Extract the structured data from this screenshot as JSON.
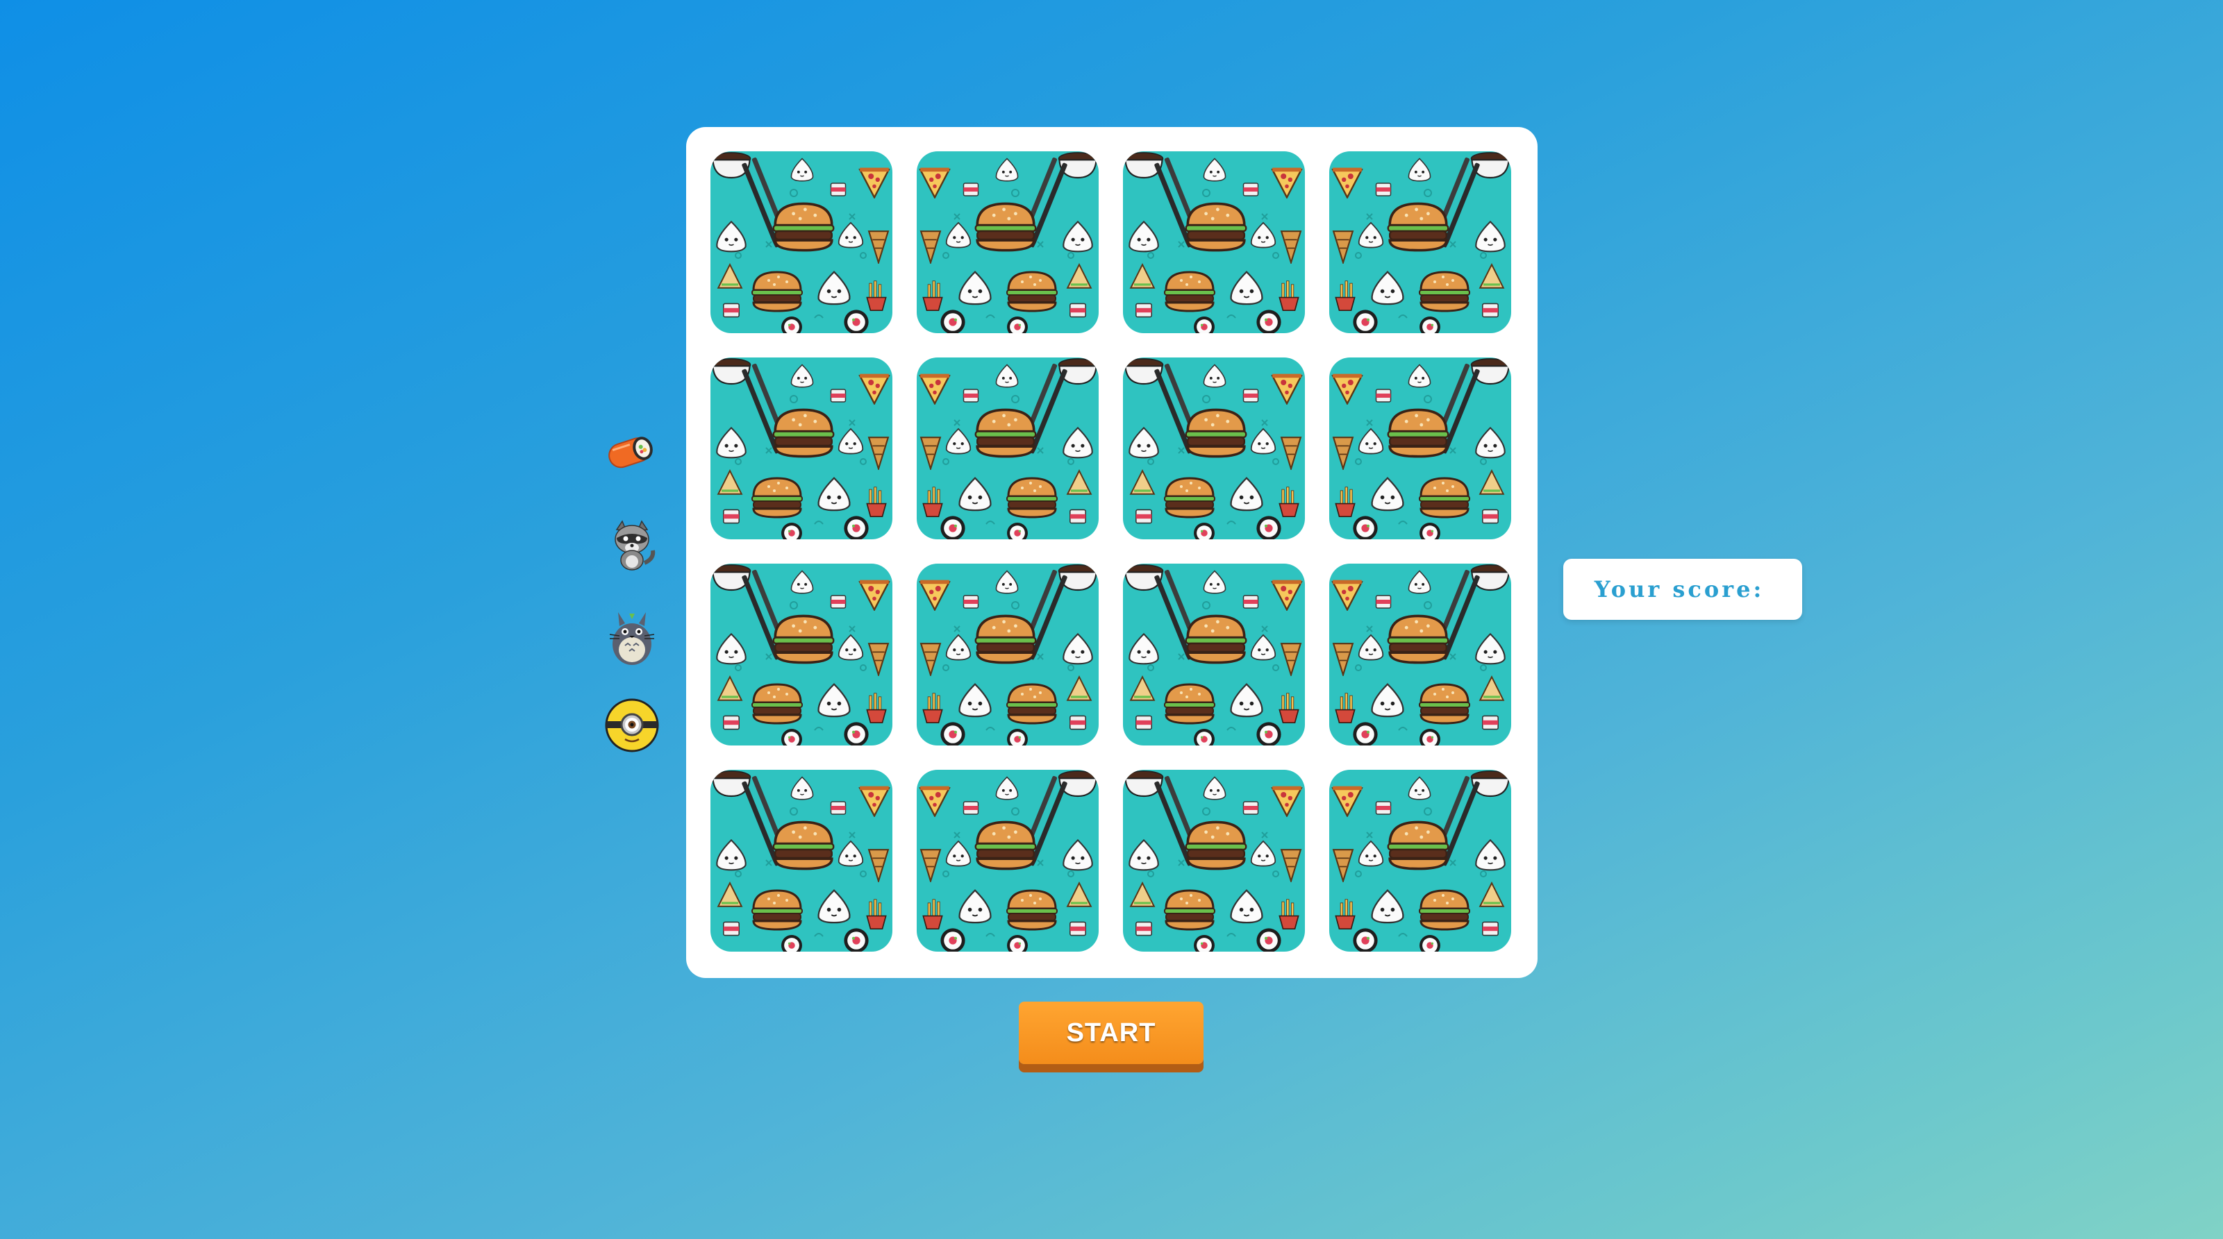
{
  "game": {
    "score_label": "Your score:",
    "score_value": "",
    "start_label": "START"
  },
  "themes": [
    {
      "icon": "sushi-roll-icon",
      "name": "sushi"
    },
    {
      "icon": "raccoon-icon",
      "name": "raccoon"
    },
    {
      "icon": "totoro-icon",
      "name": "totoro"
    },
    {
      "icon": "minion-icon",
      "name": "minion"
    }
  ],
  "board": {
    "rows": 4,
    "columns": 4,
    "card_back": "food-pattern (burgers, onigiri, pizza, sushi, chopsticks)",
    "face_down_cards": 16
  },
  "colors": {
    "background_top": "#0f8fe6",
    "background_bottom": "#80d2c6",
    "card_back": "#2fc3c0",
    "button": "#f7941d",
    "button_shadow": "#b25d15",
    "score_text": "#2a9fd0"
  }
}
